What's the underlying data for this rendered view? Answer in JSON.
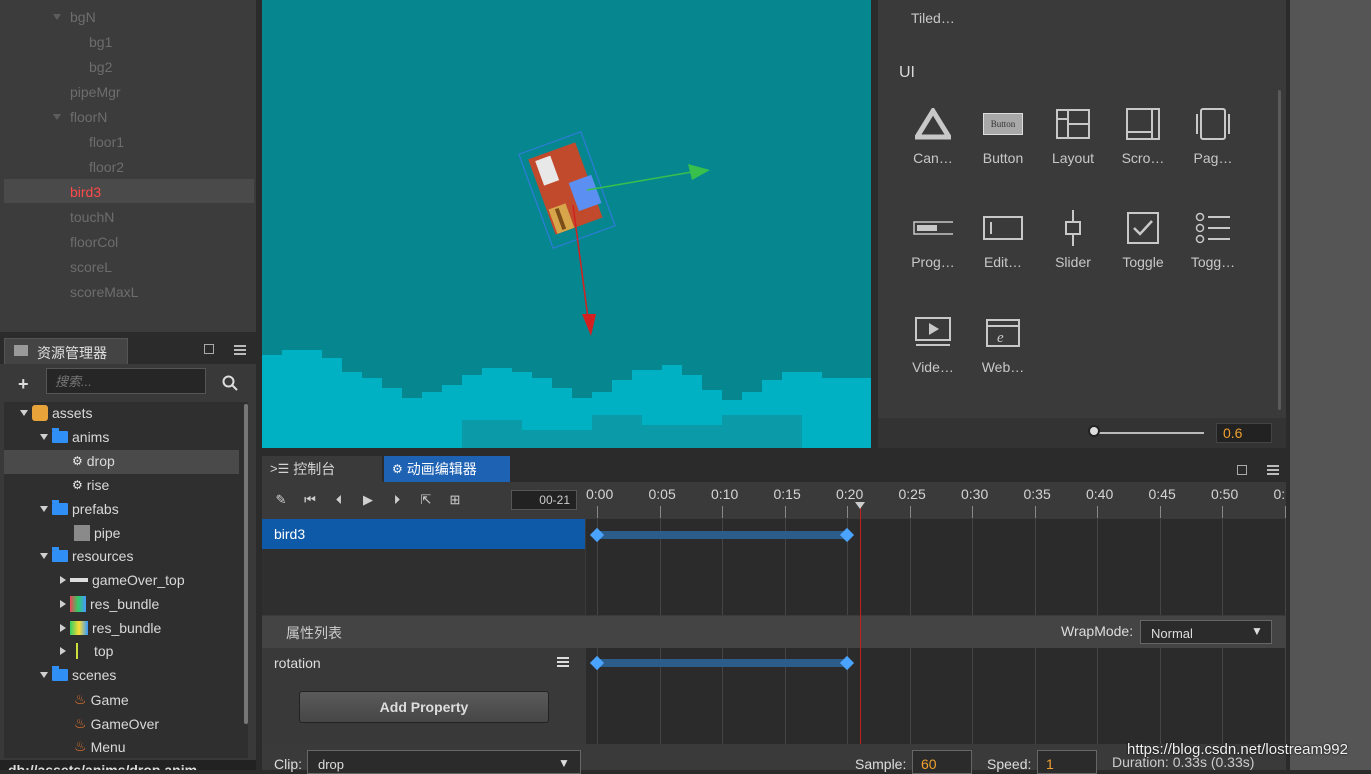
{
  "hierarchy": {
    "nodes": [
      {
        "label": "bgN"
      },
      {
        "label": "bg1"
      },
      {
        "label": "bg2"
      },
      {
        "label": "pipeMgr"
      },
      {
        "label": "floorN"
      },
      {
        "label": "floor1"
      },
      {
        "label": "floor2"
      },
      {
        "label": "bird3"
      },
      {
        "label": "touchN"
      },
      {
        "label": "floorCol"
      },
      {
        "label": "scoreL"
      },
      {
        "label": "scoreMaxL"
      }
    ]
  },
  "components": {
    "top_item": "Tiled…",
    "section": "UI",
    "row1": [
      "Can…",
      "Button",
      "Layout",
      "Scro…",
      "Pag…"
    ],
    "row2": [
      "Prog…",
      "Edit…",
      "Slider",
      "Toggle",
      "Togg…"
    ],
    "row3": [
      "Vide…",
      "Web…"
    ],
    "button_icon_text": "Button",
    "zoom_value": "0.6"
  },
  "assets": {
    "tab_label": "资源管理器",
    "search_placeholder": "搜索...",
    "tree": [
      "assets",
      "anims",
      "drop",
      "rise",
      "prefabs",
      "pipe",
      "resources",
      "gameOver_top",
      "res_bundle",
      "res_bundle",
      "top",
      "scenes",
      "Game",
      "GameOver",
      "Menu"
    ],
    "path": "db://assets/anims/drop.anim"
  },
  "anim": {
    "tab_console": "控制台",
    "tab_editor": "动画编辑器",
    "frame": "00-21",
    "ticks": [
      "0:00",
      "0:05",
      "0:10",
      "0:15",
      "0:20",
      "0:25",
      "0:30",
      "0:35",
      "0:40",
      "0:45",
      "0:50",
      "0:"
    ],
    "node_row": "bird3",
    "props_header": "属性列表",
    "wrapmode_label": "WrapMode:",
    "wrapmode_value": "Normal",
    "property": "rotation",
    "add_property": "Add Property",
    "clip_label": "Clip:",
    "clip_value": "drop",
    "sample_label": "Sample:",
    "sample_value": "60",
    "speed_label": "Speed:",
    "speed_value": "1",
    "duration": "Duration: 0.33s (0.33s)"
  },
  "watermark": "https://blog.csdn.net/lostream992",
  "colors": {
    "accent": "#4aa3ff",
    "selected": "#ff4a4a",
    "scene_bg": "#06878f",
    "orange": "#f0a030"
  }
}
